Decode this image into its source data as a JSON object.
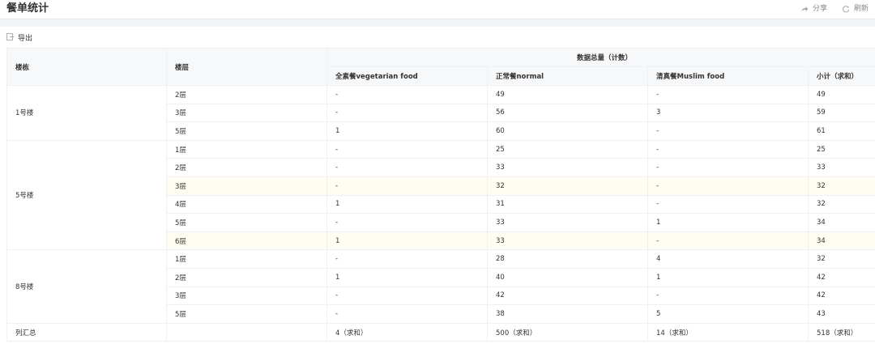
{
  "header": {
    "title": "餐单统计",
    "share_label": "分享",
    "refresh_label": "刷新"
  },
  "toolbar": {
    "export_label": "导出"
  },
  "table": {
    "col_building": "楼栋",
    "col_floor": "楼层",
    "group_header": "数据总量（计数）",
    "cols": [
      "全素餐vegetarian food",
      "正常餐normal",
      "清真餐Muslim food",
      "小计（求和）"
    ],
    "buildings": [
      {
        "name": "1号楼",
        "rows": [
          {
            "floor": "2层",
            "v": [
              "-",
              "49",
              "-",
              "49"
            ]
          },
          {
            "floor": "3层",
            "v": [
              "-",
              "56",
              "3",
              "59"
            ]
          },
          {
            "floor": "5层",
            "v": [
              "1",
              "60",
              "-",
              "61"
            ]
          }
        ]
      },
      {
        "name": "5号楼",
        "rows": [
          {
            "floor": "1层",
            "v": [
              "-",
              "25",
              "-",
              "25"
            ]
          },
          {
            "floor": "2层",
            "v": [
              "-",
              "33",
              "-",
              "33"
            ]
          },
          {
            "floor": "3层",
            "v": [
              "-",
              "32",
              "-",
              "32"
            ],
            "hl": true
          },
          {
            "floor": "4层",
            "v": [
              "1",
              "31",
              "-",
              "32"
            ]
          },
          {
            "floor": "5层",
            "v": [
              "-",
              "33",
              "1",
              "34"
            ]
          },
          {
            "floor": "6层",
            "v": [
              "1",
              "33",
              "-",
              "34"
            ],
            "hl": true
          }
        ]
      },
      {
        "name": "8号楼",
        "rows": [
          {
            "floor": "1层",
            "v": [
              "-",
              "28",
              "4",
              "32"
            ]
          },
          {
            "floor": "2层",
            "v": [
              "1",
              "40",
              "1",
              "42"
            ]
          },
          {
            "floor": "3层",
            "v": [
              "-",
              "42",
              "-",
              "42"
            ]
          },
          {
            "floor": "5层",
            "v": [
              "-",
              "38",
              "5",
              "43"
            ]
          }
        ]
      }
    ],
    "total": {
      "label": "列汇总",
      "v": [
        "4（求和）",
        "500（求和）",
        "14（求和）",
        "518（求和）"
      ]
    }
  }
}
